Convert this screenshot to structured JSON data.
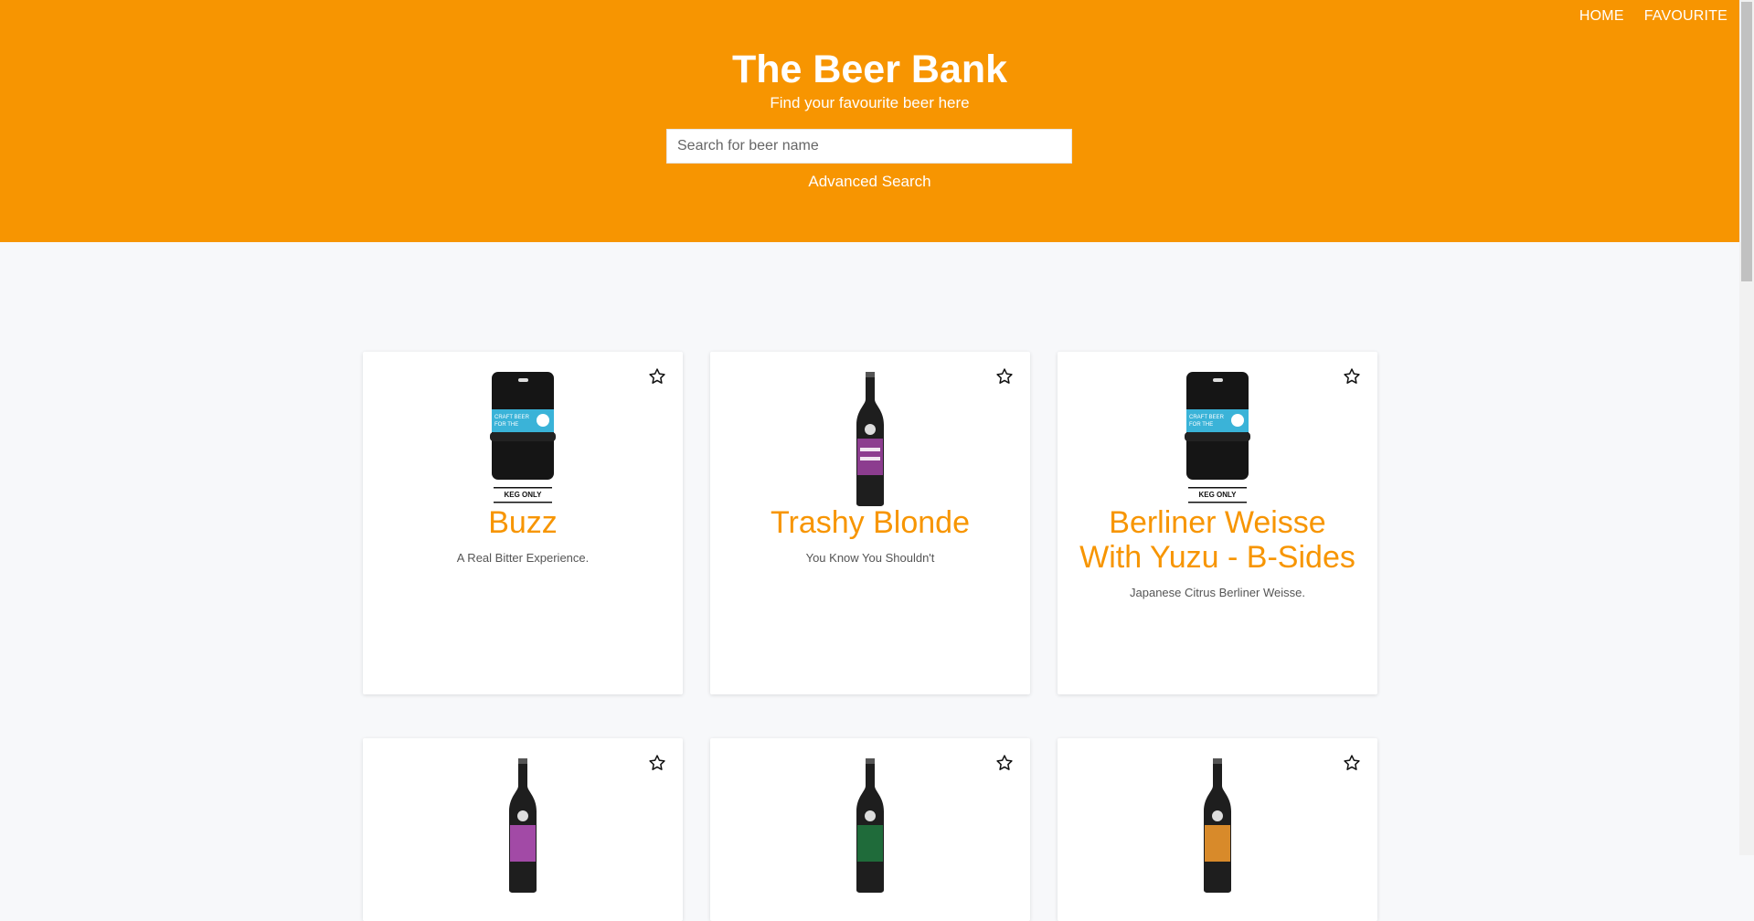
{
  "nav": {
    "home": "HOME",
    "favourite": "FAVOURITE"
  },
  "hero": {
    "title": "The Beer Bank",
    "subtitle": "Find your favourite beer here",
    "search_placeholder": "Search for beer name",
    "advanced_search": "Advanced Search"
  },
  "colors": {
    "accent": "#f79501",
    "background": "#f7f8fa",
    "card": "#ffffff"
  },
  "beers": [
    {
      "name": "Buzz",
      "tagline": "A Real Bitter Experience.",
      "image": "keg-icon",
      "keg_label": "KEG ONLY",
      "keg_text": "CRAFT BEER FOR THE PEOPLE"
    },
    {
      "name": "Trashy Blonde",
      "tagline": "You Know You Shouldn't",
      "image": "bottle-icon"
    },
    {
      "name": "Berliner Weisse With Yuzu - B-Sides",
      "tagline": "Japanese Citrus Berliner Weisse.",
      "image": "keg-icon",
      "keg_label": "KEG ONLY",
      "keg_text": "CRAFT BEER FOR THE PEOPLE"
    },
    {
      "name": "",
      "tagline": "",
      "image": "bottle-icon"
    },
    {
      "name": "",
      "tagline": "",
      "image": "bottle-icon"
    },
    {
      "name": "",
      "tagline": "",
      "image": "bottle-icon"
    }
  ]
}
